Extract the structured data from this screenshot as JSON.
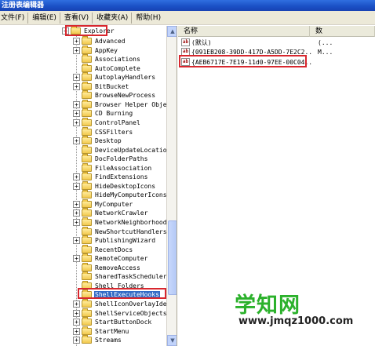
{
  "window": {
    "title": "注册表编辑器"
  },
  "menu": [
    "文件(F)",
    "编辑(E)",
    "查看(V)",
    "收藏夹(A)",
    "帮助(H)"
  ],
  "tree": {
    "parent": "Explorer",
    "selected": "ShellExecuteHooks",
    "items": [
      {
        "label": "Advanced",
        "expandable": true
      },
      {
        "label": "AppKey",
        "expandable": true
      },
      {
        "label": "Associations",
        "expandable": false
      },
      {
        "label": "AutoComplete",
        "expandable": false
      },
      {
        "label": "AutoplayHandlers",
        "expandable": true
      },
      {
        "label": "BitBucket",
        "expandable": true
      },
      {
        "label": "BrowseNewProcess",
        "expandable": false
      },
      {
        "label": "Browser Helper Objects",
        "expandable": true
      },
      {
        "label": "CD Burning",
        "expandable": true
      },
      {
        "label": "ControlPanel",
        "expandable": true
      },
      {
        "label": "CSSFilters",
        "expandable": false
      },
      {
        "label": "Desktop",
        "expandable": true
      },
      {
        "label": "DeviceUpdateLocations",
        "expandable": false
      },
      {
        "label": "DocFolderPaths",
        "expandable": false
      },
      {
        "label": "FileAssociation",
        "expandable": false
      },
      {
        "label": "FindExtensions",
        "expandable": true
      },
      {
        "label": "HideDesktopIcons",
        "expandable": true
      },
      {
        "label": "HideMyComputerIcons",
        "expandable": false
      },
      {
        "label": "MyComputer",
        "expandable": true
      },
      {
        "label": "NetworkCrawler",
        "expandable": true
      },
      {
        "label": "NetworkNeighborhood",
        "expandable": true
      },
      {
        "label": "NewShortcutHandlers",
        "expandable": false
      },
      {
        "label": "PublishingWizard",
        "expandable": true
      },
      {
        "label": "RecentDocs",
        "expandable": false
      },
      {
        "label": "RemoteComputer",
        "expandable": true
      },
      {
        "label": "RemoveAccess",
        "expandable": false
      },
      {
        "label": "SharedTaskScheduler",
        "expandable": false
      },
      {
        "label": "Shell Folders",
        "expandable": false
      },
      {
        "label": "ShellExecuteHooks",
        "expandable": false
      },
      {
        "label": "ShellIconOverlayIdentifiers",
        "expandable": true
      },
      {
        "label": "ShellServiceObjects",
        "expandable": true
      },
      {
        "label": "StartButtonDock",
        "expandable": true
      },
      {
        "label": "StartMenu",
        "expandable": true
      },
      {
        "label": "Streams",
        "expandable": true
      }
    ]
  },
  "list": {
    "columns": [
      "名称",
      "数"
    ],
    "entries": [
      {
        "icon": "ab",
        "name": "(默认)",
        "data": "(..."
      },
      {
        "icon": "ab",
        "name": "{091EB208-39DD-417D-A5DD-7E2C2...",
        "data": "M..."
      },
      {
        "icon": "ab",
        "name": "{AEB6717E-7E19-11d0-97EE-00C04...",
        "data": ""
      }
    ]
  },
  "watermark": {
    "text": "学知网",
    "url": "www.jmqz1000.com"
  },
  "colors": {
    "highlight_box": "#d8272e",
    "selection": "#316ac5",
    "watermark_green": "#2bb12b"
  }
}
